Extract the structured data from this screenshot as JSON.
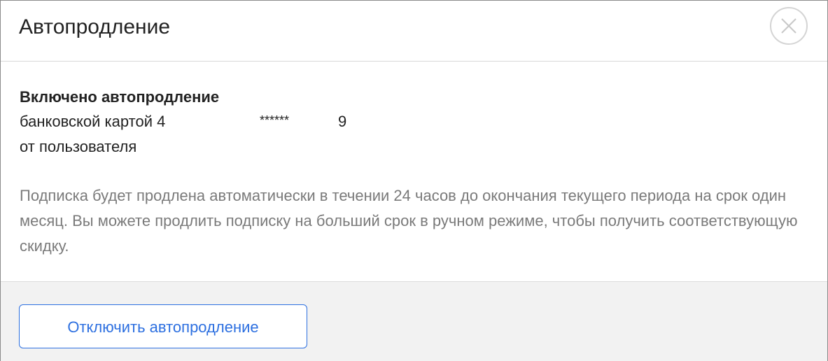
{
  "dialog": {
    "title": "Автопродление",
    "close_icon": "close-icon"
  },
  "status": {
    "title": "Включено автопродление",
    "card_prefix": "банковской картой 4",
    "card_mask": "******",
    "card_suffix": "9",
    "user_line": "от пользователя"
  },
  "description": "Подписка будет продлена автоматически в течении 24 часов до окончания текущего периода на срок один месяц. Вы можете продлить подписку на больший срок в ручном режиме, чтобы получить соответствующую скидку.",
  "footer": {
    "disable_label": "Отключить автопродление"
  },
  "colors": {
    "accent": "#2c6fe0",
    "muted_text": "#7a7a7a",
    "footer_bg": "#f2f2f2"
  }
}
